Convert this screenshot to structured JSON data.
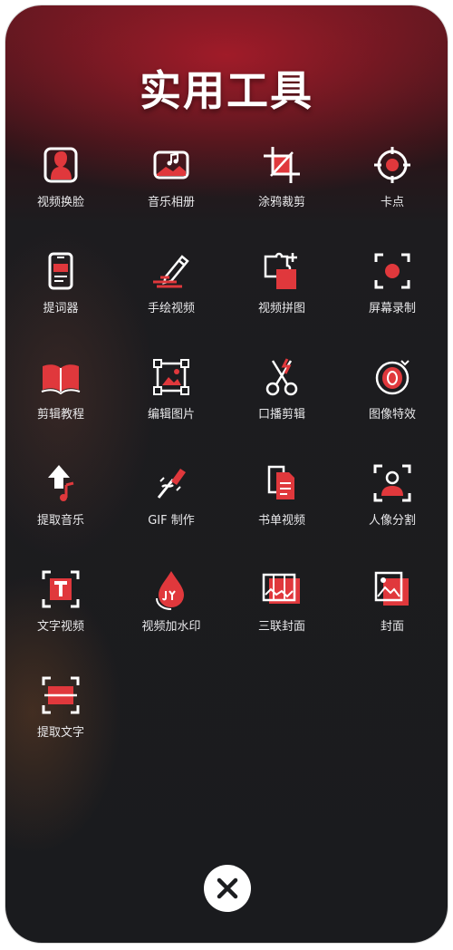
{
  "title": "实用工具",
  "tools": [
    {
      "label": "视频换脸",
      "icon": "face-swap-icon"
    },
    {
      "label": "音乐相册",
      "icon": "music-album-icon"
    },
    {
      "label": "涂鸦裁剪",
      "icon": "crop-icon"
    },
    {
      "label": "卡点",
      "icon": "beat-target-icon"
    },
    {
      "label": "提词器",
      "icon": "teleprompter-icon"
    },
    {
      "label": "手绘视频",
      "icon": "pen-draw-icon"
    },
    {
      "label": "视频拼图",
      "icon": "puzzle-icon"
    },
    {
      "label": "屏幕录制",
      "icon": "screen-record-icon"
    },
    {
      "label": "剪辑教程",
      "icon": "book-icon"
    },
    {
      "label": "编辑图片",
      "icon": "image-edit-icon"
    },
    {
      "label": "口播剪辑",
      "icon": "scissors-icon"
    },
    {
      "label": "图像特效",
      "icon": "image-effect-icon"
    },
    {
      "label": "提取音乐",
      "icon": "extract-music-icon"
    },
    {
      "label": "GIF 制作",
      "icon": "gif-brush-icon"
    },
    {
      "label": "书单视频",
      "icon": "document-icon"
    },
    {
      "label": "人像分割",
      "icon": "portrait-segment-icon"
    },
    {
      "label": "文字视频",
      "icon": "text-video-icon"
    },
    {
      "label": "视频加水印",
      "icon": "watermark-drop-icon"
    },
    {
      "label": "三联封面",
      "icon": "triptych-cover-icon"
    },
    {
      "label": "封面",
      "icon": "cover-icon"
    },
    {
      "label": "提取文字",
      "icon": "extract-text-icon"
    }
  ],
  "close_icon": "close-icon",
  "colors": {
    "accent": "#e0383c",
    "icon_line": "#ffffff",
    "label": "#e8e8ea"
  }
}
